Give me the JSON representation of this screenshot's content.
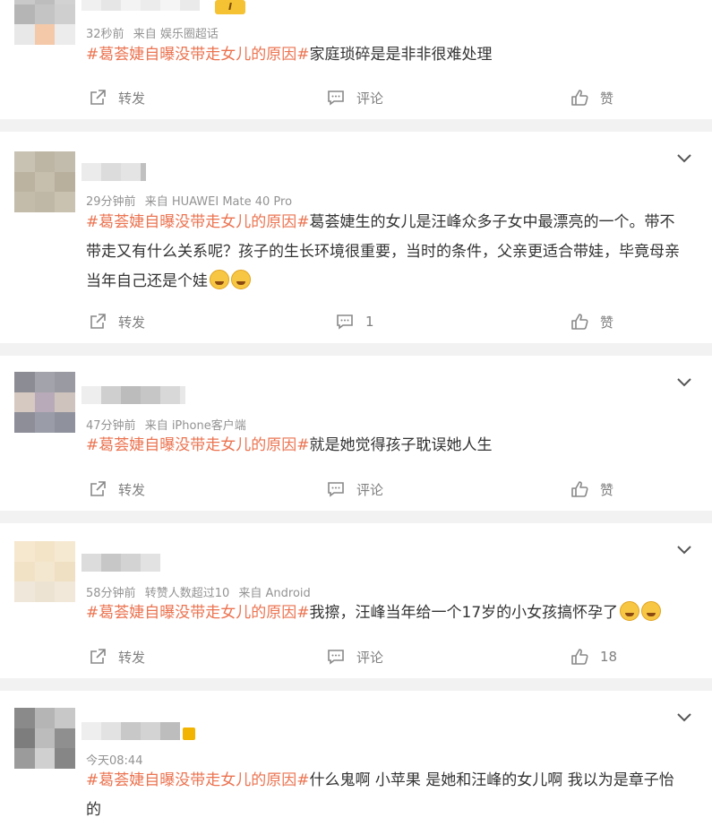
{
  "actions": {
    "share": "转发",
    "comment": "评论",
    "like": "赞"
  },
  "topic_tag": "#葛荟婕自曝没带走女儿的原因#",
  "comments": [
    {
      "time": "32秒前",
      "source": "来自 娱乐圈超话",
      "body": "家庭琐碎是是非非很难处理",
      "comment_label": "评论",
      "like_label": "赞",
      "level_badge": "I"
    },
    {
      "time": "29分钟前",
      "source": "来自 HUAWEI Mate 40 Pro",
      "body": "葛荟婕生的女儿是汪峰众多子女中最漂亮的一个。带不带走又有什么关系呢？孩子的生长环境很重要，当时的条件，父亲更适合带娃，毕竟母亲当年自己还是个娃",
      "comment_label": "1",
      "like_label": "赞",
      "emojis": [
        "laugh-cry-emoji",
        "grin-emoji"
      ]
    },
    {
      "time": "47分钟前",
      "source": "来自 iPhone客户端",
      "body": "就是她觉得孩子耽误她人生",
      "comment_label": "评论",
      "like_label": "赞"
    },
    {
      "time": "58分钟前",
      "reposts_note": "转赞人数超过10",
      "source": "来自 Android",
      "body": "我擦，汪峰当年给一个17岁的小女孩搞怀孕了",
      "comment_label": "评论",
      "like_label": "18",
      "emojis": [
        "dizzy-emoji",
        "dizzy-emoji"
      ]
    },
    {
      "time": "今天08:44",
      "source": "",
      "body": "什么鬼啊 小苹果 是她和汪峰的女儿啊 我以为是章子怡的",
      "comment_label": "评论",
      "like_label": "赞"
    }
  ]
}
